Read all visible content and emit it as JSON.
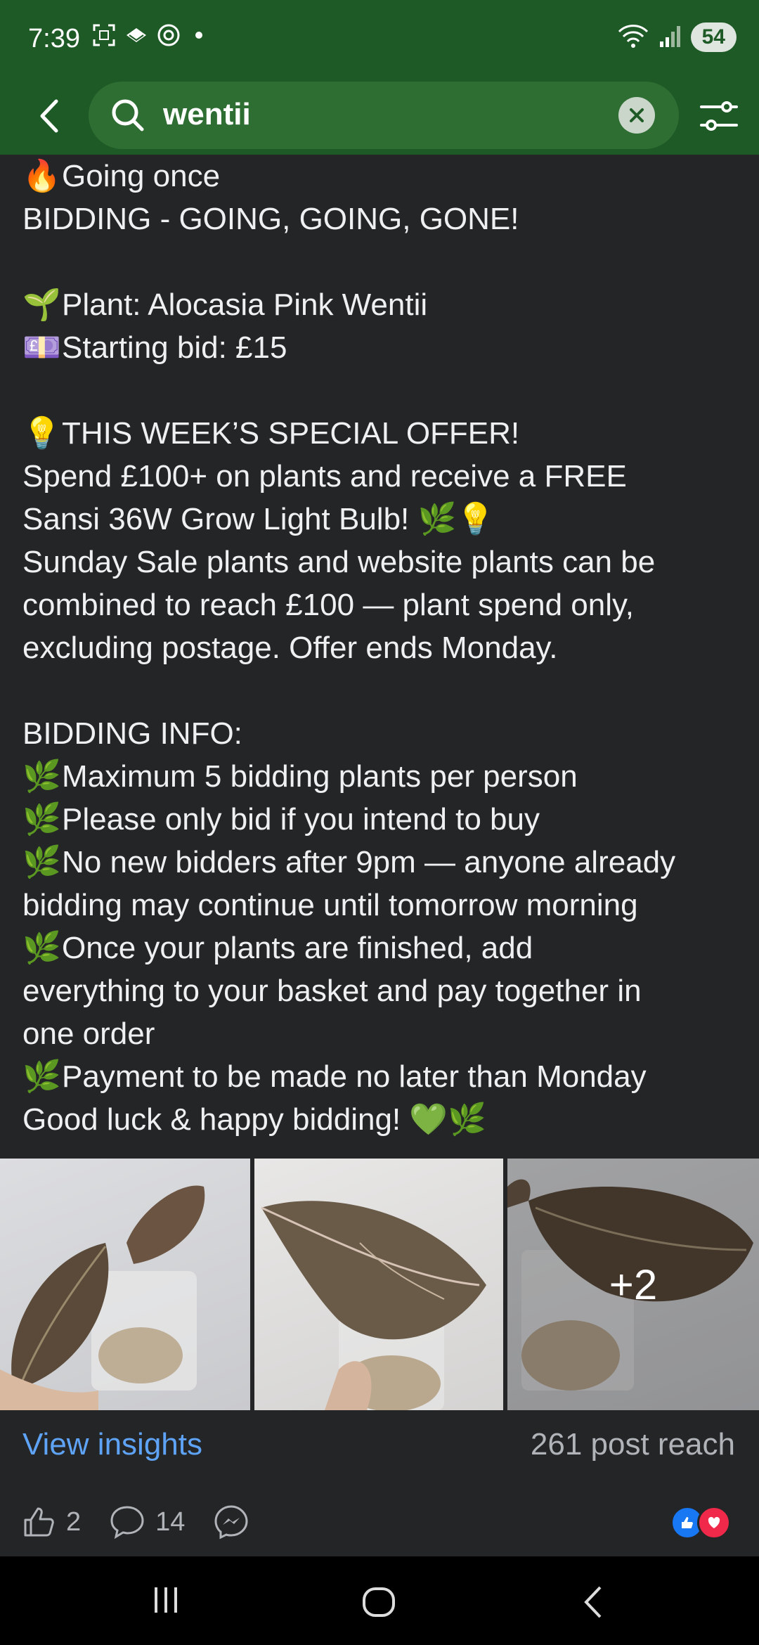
{
  "status_bar": {
    "time": "7:39",
    "battery": "54"
  },
  "search": {
    "query": "wentii"
  },
  "post": {
    "lines": [
      {
        "emoji": "🔥",
        "text": "Going once"
      },
      {
        "emoji": "",
        "text": "BIDDING - GOING, GOING, GONE!"
      },
      {
        "blank": true
      },
      {
        "emoji": "🌱",
        "text": "Plant: Alocasia Pink Wentii"
      },
      {
        "emoji": "💷",
        "text": "Starting bid: £15"
      },
      {
        "blank": true
      },
      {
        "emoji": "💡",
        "text": "THIS WEEK’S SPECIAL OFFER!"
      },
      {
        "emoji": "",
        "text": "Spend £100+ on plants and receive a FREE"
      },
      {
        "emoji": "",
        "text": "Sansi 36W Grow Light Bulb! 🌿💡"
      },
      {
        "emoji": "",
        "text": "Sunday Sale plants and website plants can be"
      },
      {
        "emoji": "",
        "text": "combined to reach £100 — plant spend only,"
      },
      {
        "emoji": "",
        "text": "excluding postage. Offer ends Monday."
      },
      {
        "blank": true
      },
      {
        "emoji": "",
        "text": "BIDDING INFO:"
      },
      {
        "emoji": "🌿",
        "text": "Maximum 5 bidding plants per person"
      },
      {
        "emoji": "🌿",
        "text": "Please only bid if you intend to buy"
      },
      {
        "emoji": "🌿",
        "text": "No new bidders after 9pm — anyone already"
      },
      {
        "emoji": "",
        "text": "bidding may continue until tomorrow morning"
      },
      {
        "emoji": "🌿",
        "text": "Once your plants are finished, add"
      },
      {
        "emoji": "",
        "text": "everything to your basket and pay together in"
      },
      {
        "emoji": "",
        "text": "one order"
      },
      {
        "emoji": "🌿",
        "text": "Payment to be made no later than Monday"
      },
      {
        "emoji": "",
        "text": "Good luck & happy bidding! 💚🌿"
      }
    ],
    "more_photos": "+2",
    "view_insights": "View insights",
    "post_reach": "261 post reach",
    "like_count": "2",
    "comment_count": "14"
  },
  "icons": {
    "back": "back-arrow-icon",
    "search": "search-icon",
    "clear": "clear-icon",
    "filter": "filter-icon",
    "like": "thumbs-up-icon",
    "comment": "comment-icon",
    "messenger": "messenger-icon"
  },
  "colors": {
    "header": "#1e5a26",
    "link": "#5ea3f5",
    "background": "#242527"
  }
}
